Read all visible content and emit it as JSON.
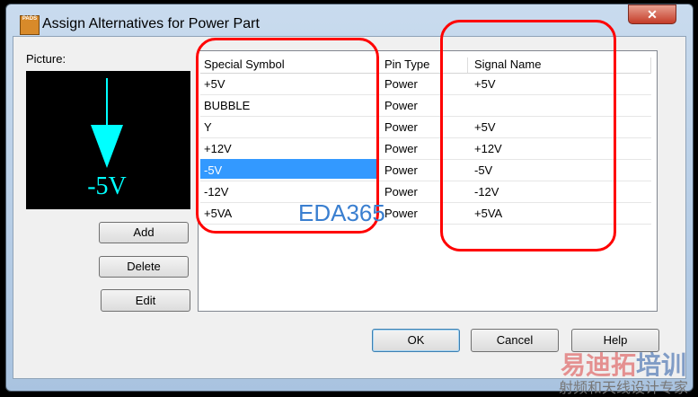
{
  "window": {
    "title": "Assign Alternatives for Power Part",
    "app_icon_text": "PADS",
    "close": "✕"
  },
  "picture": {
    "label": "Picture:",
    "symbol_text": "-5V",
    "symbol_color": "#00ffff"
  },
  "buttons": {
    "add": "Add",
    "delete": "Delete",
    "edit": "Edit",
    "ok": "OK",
    "cancel": "Cancel",
    "help": "Help"
  },
  "table": {
    "columns": [
      "Special Symbol",
      "Pin Type",
      "Signal Name"
    ],
    "rows": [
      {
        "symbol": "+5V",
        "type": "Power",
        "signal": "+5V"
      },
      {
        "symbol": "BUBBLE",
        "type": "Power",
        "signal": ""
      },
      {
        "symbol": "Y",
        "type": "Power",
        "signal": "+5V"
      },
      {
        "symbol": "+12V",
        "type": "Power",
        "signal": "+12V"
      },
      {
        "symbol": "-5V",
        "type": "Power",
        "signal": "-5V"
      },
      {
        "symbol": "-12V",
        "type": "Power",
        "signal": "-12V"
      },
      {
        "symbol": "+5VA",
        "type": "Power",
        "signal": "+5VA"
      }
    ],
    "selected_index": 4
  },
  "watermarks": {
    "eda": "EDA365",
    "cn_main_red": "易迪拓",
    "cn_main_blue": "培训",
    "cn_sub": "射频和天线设计专家"
  },
  "colors": {
    "selection": "#3399ff",
    "annotation": "#ff0000"
  }
}
